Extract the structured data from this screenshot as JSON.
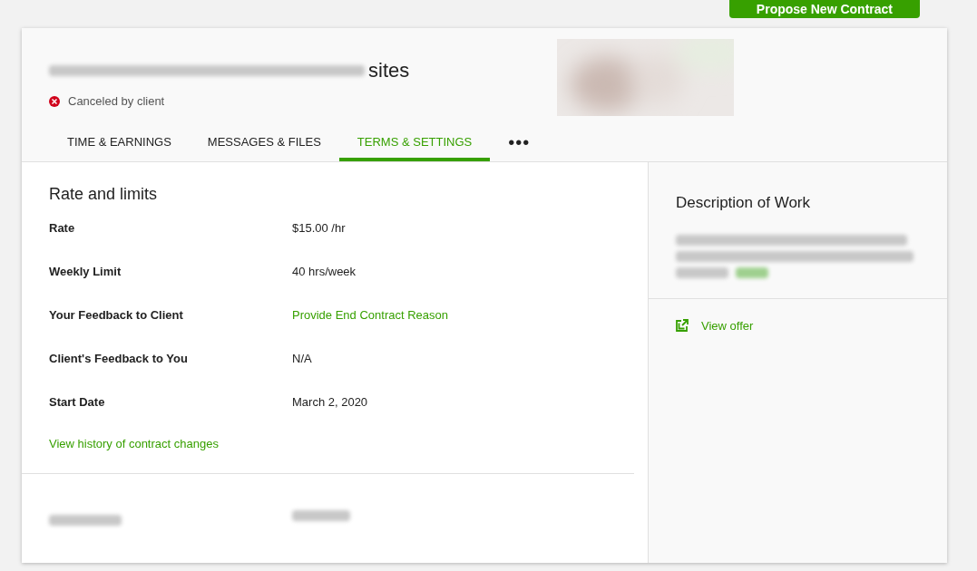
{
  "top_button": "Propose New Contract",
  "header": {
    "title_visible": "sites",
    "status": "Canceled by client"
  },
  "tabs": [
    {
      "label": "TIME & EARNINGS",
      "selected": false
    },
    {
      "label": "MESSAGES & FILES",
      "selected": false
    },
    {
      "label": "TERMS & SETTINGS",
      "selected": true
    },
    {
      "label": "•••",
      "selected": false,
      "kind": "more"
    }
  ],
  "rate_section": {
    "title": "Rate and limits",
    "rows": [
      {
        "label": "Rate",
        "value": "$15.00 /hr",
        "kind": "text"
      },
      {
        "label": "Weekly Limit",
        "value": "40 hrs/week",
        "kind": "text"
      },
      {
        "label": "Your Feedback to Client",
        "value": "Provide End Contract Reason",
        "kind": "link"
      },
      {
        "label": "Client's Feedback to You",
        "value": "N/A",
        "kind": "text"
      },
      {
        "label": "Start Date",
        "value": "March 2, 2020",
        "kind": "text"
      }
    ],
    "history_link": "View history of contract changes"
  },
  "description": {
    "title": "Description of Work",
    "view_offer": "View offer"
  }
}
